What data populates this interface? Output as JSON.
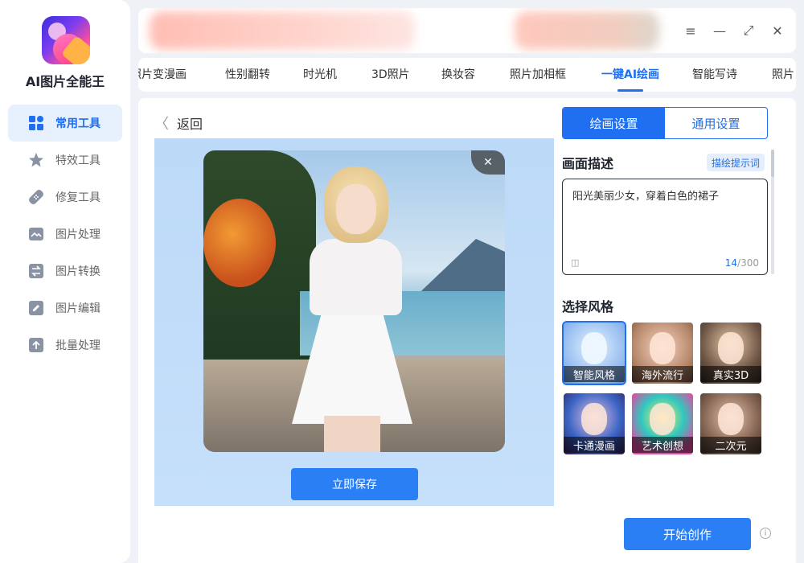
{
  "app": {
    "title": "AI图片全能王",
    "logo_icon": "app-logo-icon"
  },
  "sidebar": {
    "items": [
      {
        "label": "常用工具",
        "icon": "grid-icon",
        "active": true
      },
      {
        "label": "特效工具",
        "icon": "star-icon",
        "active": false
      },
      {
        "label": "修复工具",
        "icon": "bandage-icon",
        "active": false
      },
      {
        "label": "图片处理",
        "icon": "image-icon",
        "active": false
      },
      {
        "label": "图片转换",
        "icon": "swap-icon",
        "active": false
      },
      {
        "label": "图片编辑",
        "icon": "edit-icon",
        "active": false
      },
      {
        "label": "批量处理",
        "icon": "upload-icon",
        "active": false
      }
    ]
  },
  "window": {
    "menu_icon": "≡",
    "minimize_icon": "—",
    "maximize_icon": "⤢",
    "close_icon": "✕"
  },
  "tabs": [
    {
      "label": "照片变漫画"
    },
    {
      "label": "性别翻转"
    },
    {
      "label": "时光机"
    },
    {
      "label": "3D照片"
    },
    {
      "label": "换妆容"
    },
    {
      "label": "照片加相框"
    },
    {
      "label": "一键AI绘画",
      "active": true
    },
    {
      "label": "智能写诗"
    },
    {
      "label": "照片"
    }
  ],
  "main": {
    "back_label": "返回",
    "back_chevron": "〈",
    "close_glyph": "✕",
    "save_label": "立即保存",
    "accent_color": "#2a7ff5"
  },
  "settings": {
    "tabs": [
      {
        "label": "绘画设置",
        "active": true
      },
      {
        "label": "通用设置",
        "active": false
      }
    ],
    "desc_title": "画面描述",
    "hint_label": "描绘提示词",
    "desc_value": "阳光美丽少女，穿着白色的裙子",
    "char_count": "14",
    "char_max": "/300",
    "style_title": "选择风格",
    "styles": [
      {
        "label": "智能风格",
        "selected": true
      },
      {
        "label": "海外流行",
        "selected": false
      },
      {
        "label": "真实3D",
        "selected": false
      },
      {
        "label": "卡通漫画",
        "selected": false
      },
      {
        "label": "艺术创想",
        "selected": false
      },
      {
        "label": "二次元",
        "selected": false
      }
    ],
    "start_label": "开始创作",
    "info_glyph": "i"
  }
}
